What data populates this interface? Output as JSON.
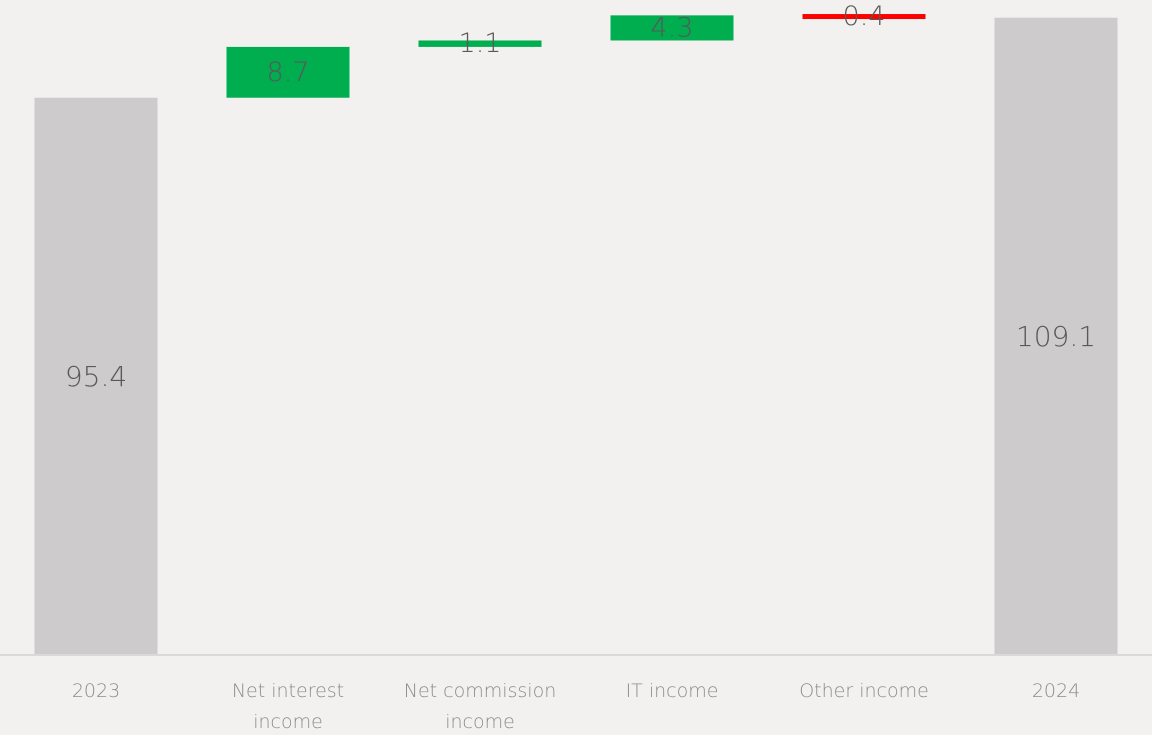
{
  "chart_data": {
    "type": "waterfall",
    "title": "",
    "xlabel": "",
    "ylabel": "",
    "ylim": [
      0,
      109.1
    ],
    "grid": false,
    "legend": "none",
    "categories": [
      [
        "2023"
      ],
      [
        "Net interest",
        "income"
      ],
      [
        "Net commission",
        "income"
      ],
      [
        "IT income"
      ],
      [
        "Other income"
      ],
      [
        "2024"
      ]
    ],
    "bars": [
      {
        "kind": "total",
        "value": 95.4,
        "label": "95.4"
      },
      {
        "kind": "delta",
        "value": 8.7,
        "label": "8.7"
      },
      {
        "kind": "delta",
        "value": 1.1,
        "label": "1.1"
      },
      {
        "kind": "delta",
        "value": 4.3,
        "label": "4.3"
      },
      {
        "kind": "delta",
        "value": -0.4,
        "label": "0.4"
      },
      {
        "kind": "total",
        "value": 109.1,
        "label": "109.1"
      }
    ],
    "colors": {
      "total": "#cdcbcb",
      "increase": "#00ad4f",
      "decrease": "#ff0000",
      "axis": "#d9d9d9",
      "background": "#f2f1ef"
    }
  }
}
